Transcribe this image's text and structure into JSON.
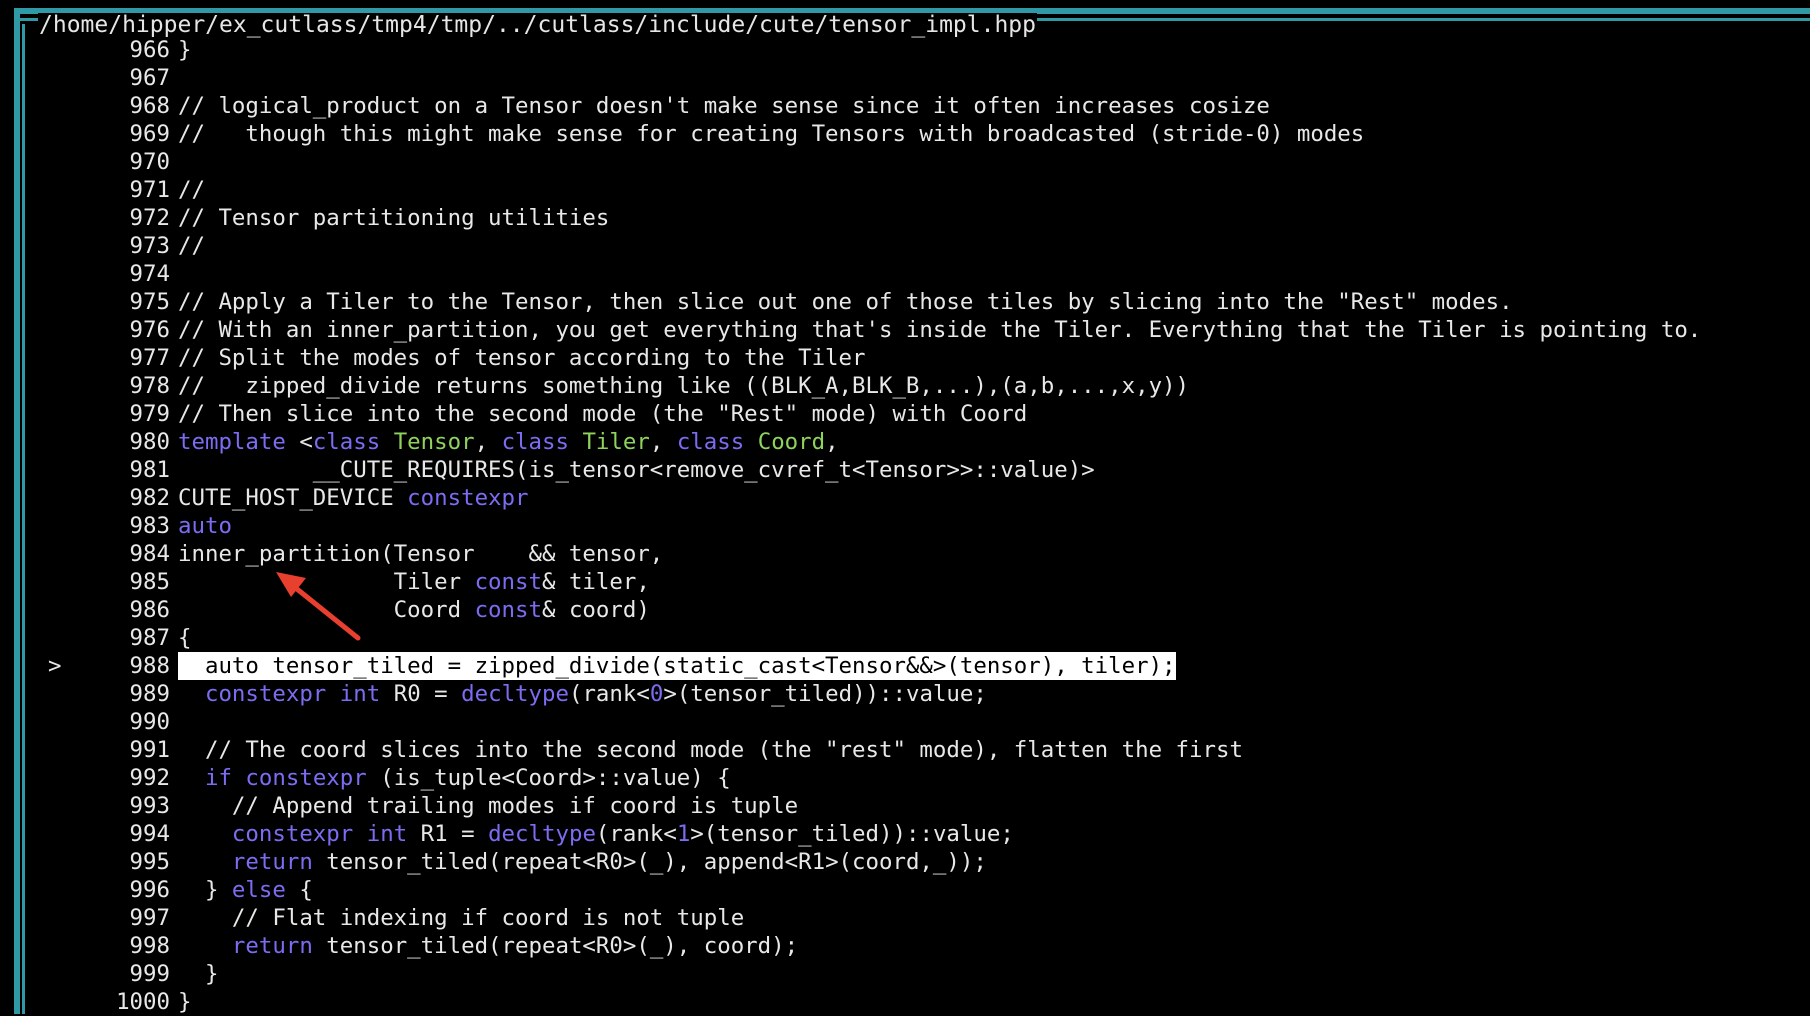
{
  "window": {
    "title": "/home/hipper/ex_cutlass/tmp4/tmp/../cutlass/include/cute/tensor_impl.hpp"
  },
  "editor": {
    "current_line": 988,
    "current_marker": ">",
    "lines": [
      {
        "num": "966",
        "segments": [
          {
            "t": "}"
          }
        ]
      },
      {
        "num": "967",
        "segments": []
      },
      {
        "num": "968",
        "segments": [
          {
            "t": "// logical_product on a Tensor doesn't make sense since it often increases cosize"
          }
        ]
      },
      {
        "num": "969",
        "segments": [
          {
            "t": "//   though this might make sense for creating Tensors with broadcasted (stride-0) modes"
          }
        ]
      },
      {
        "num": "970",
        "segments": []
      },
      {
        "num": "971",
        "segments": [
          {
            "t": "//"
          }
        ]
      },
      {
        "num": "972",
        "segments": [
          {
            "t": "// Tensor partitioning utilities"
          }
        ]
      },
      {
        "num": "973",
        "segments": [
          {
            "t": "//"
          }
        ]
      },
      {
        "num": "974",
        "segments": []
      },
      {
        "num": "975",
        "segments": [
          {
            "t": "// Apply a Tiler to the Tensor, then slice out one of those tiles by slicing into the \"Rest\" modes."
          }
        ]
      },
      {
        "num": "976",
        "segments": [
          {
            "t": "// With an inner_partition, you get everything that's inside the Tiler. Everything that the Tiler is pointing to."
          }
        ]
      },
      {
        "num": "977",
        "segments": [
          {
            "t": "// Split the modes of tensor according to the Tiler"
          }
        ]
      },
      {
        "num": "978",
        "segments": [
          {
            "t": "//   zipped_divide returns something like ((BLK_A,BLK_B,...),(a,b,...,x,y))"
          }
        ]
      },
      {
        "num": "979",
        "segments": [
          {
            "t": "// Then slice into the second mode (the \"Rest\" mode) with Coord"
          }
        ]
      },
      {
        "num": "980",
        "segments": [
          {
            "t": "template",
            "c": "kw"
          },
          {
            "t": " <"
          },
          {
            "t": "class",
            "c": "kw"
          },
          {
            "t": " "
          },
          {
            "t": "Tensor",
            "c": "ty"
          },
          {
            "t": ", "
          },
          {
            "t": "class",
            "c": "kw"
          },
          {
            "t": " "
          },
          {
            "t": "Tiler",
            "c": "ty"
          },
          {
            "t": ", "
          },
          {
            "t": "class",
            "c": "kw"
          },
          {
            "t": " "
          },
          {
            "t": "Coord",
            "c": "ty"
          },
          {
            "t": ","
          }
        ]
      },
      {
        "num": "981",
        "segments": [
          {
            "t": "          __CUTE_REQUIRES(is_tensor<remove_cvref_t<Tensor>>::value)>"
          }
        ]
      },
      {
        "num": "982",
        "segments": [
          {
            "t": "CUTE_HOST_DEVICE "
          },
          {
            "t": "constexpr",
            "c": "kw"
          }
        ]
      },
      {
        "num": "983",
        "segments": [
          {
            "t": "auto",
            "c": "kw"
          }
        ]
      },
      {
        "num": "984",
        "segments": [
          {
            "t": "inner_partition(Tensor    && tensor,"
          }
        ]
      },
      {
        "num": "985",
        "segments": [
          {
            "t": "                Tiler "
          },
          {
            "t": "const",
            "c": "kw"
          },
          {
            "t": "& tiler,"
          }
        ]
      },
      {
        "num": "986",
        "segments": [
          {
            "t": "                Coord "
          },
          {
            "t": "const",
            "c": "kw"
          },
          {
            "t": "& coord)"
          }
        ]
      },
      {
        "num": "987",
        "segments": [
          {
            "t": "{"
          }
        ]
      },
      {
        "num": "988",
        "highlight": true,
        "segments": [
          {
            "t": "  auto tensor_tiled = zipped_divide(static_cast<Tensor&&>(tensor), tiler);"
          }
        ]
      },
      {
        "num": "989",
        "segments": [
          {
            "t": "  "
          },
          {
            "t": "constexpr",
            "c": "kw"
          },
          {
            "t": " "
          },
          {
            "t": "int",
            "c": "kw"
          },
          {
            "t": " R0 = "
          },
          {
            "t": "decltype",
            "c": "kw"
          },
          {
            "t": "(rank<"
          },
          {
            "t": "0",
            "c": "nm"
          },
          {
            "t": ">(tensor_tiled))::value;"
          }
        ]
      },
      {
        "num": "990",
        "segments": []
      },
      {
        "num": "991",
        "segments": [
          {
            "t": "  // The coord slices into the second mode (the \"rest\" mode), flatten the first"
          }
        ]
      },
      {
        "num": "992",
        "segments": [
          {
            "t": "  "
          },
          {
            "t": "if",
            "c": "kw"
          },
          {
            "t": " "
          },
          {
            "t": "constexpr",
            "c": "kw"
          },
          {
            "t": " (is_tuple<Coord>::value) {"
          }
        ]
      },
      {
        "num": "993",
        "segments": [
          {
            "t": "    // Append trailing modes if coord is tuple"
          }
        ]
      },
      {
        "num": "994",
        "segments": [
          {
            "t": "    "
          },
          {
            "t": "constexpr",
            "c": "kw"
          },
          {
            "t": " "
          },
          {
            "t": "int",
            "c": "kw"
          },
          {
            "t": " R1 = "
          },
          {
            "t": "decltype",
            "c": "kw"
          },
          {
            "t": "(rank<"
          },
          {
            "t": "1",
            "c": "nm"
          },
          {
            "t": ">(tensor_tiled))::value;"
          }
        ]
      },
      {
        "num": "995",
        "segments": [
          {
            "t": "    "
          },
          {
            "t": "return",
            "c": "kw"
          },
          {
            "t": " tensor_tiled(repeat<R0>(_), append<R1>(coord,_));"
          }
        ]
      },
      {
        "num": "996",
        "segments": [
          {
            "t": "  } "
          },
          {
            "t": "else",
            "c": "kw"
          },
          {
            "t": " {"
          }
        ]
      },
      {
        "num": "997",
        "segments": [
          {
            "t": "    // Flat indexing if coord is not tuple"
          }
        ]
      },
      {
        "num": "998",
        "segments": [
          {
            "t": "    "
          },
          {
            "t": "return",
            "c": "kw"
          },
          {
            "t": " tensor_tiled(repeat<R0>(_), coord);"
          }
        ]
      },
      {
        "num": "999",
        "segments": [
          {
            "t": "  }"
          }
        ]
      },
      {
        "num": "1000",
        "segments": [
          {
            "t": "}"
          }
        ]
      }
    ]
  },
  "annotation": {
    "arrow_color": "#e8402e",
    "points_to": "inner_partition"
  },
  "colors": {
    "border": "#2f9aa6",
    "keyword": "#7b6cf2",
    "type": "#8fd35c",
    "text": "#e8e8e8",
    "background": "#000000"
  }
}
